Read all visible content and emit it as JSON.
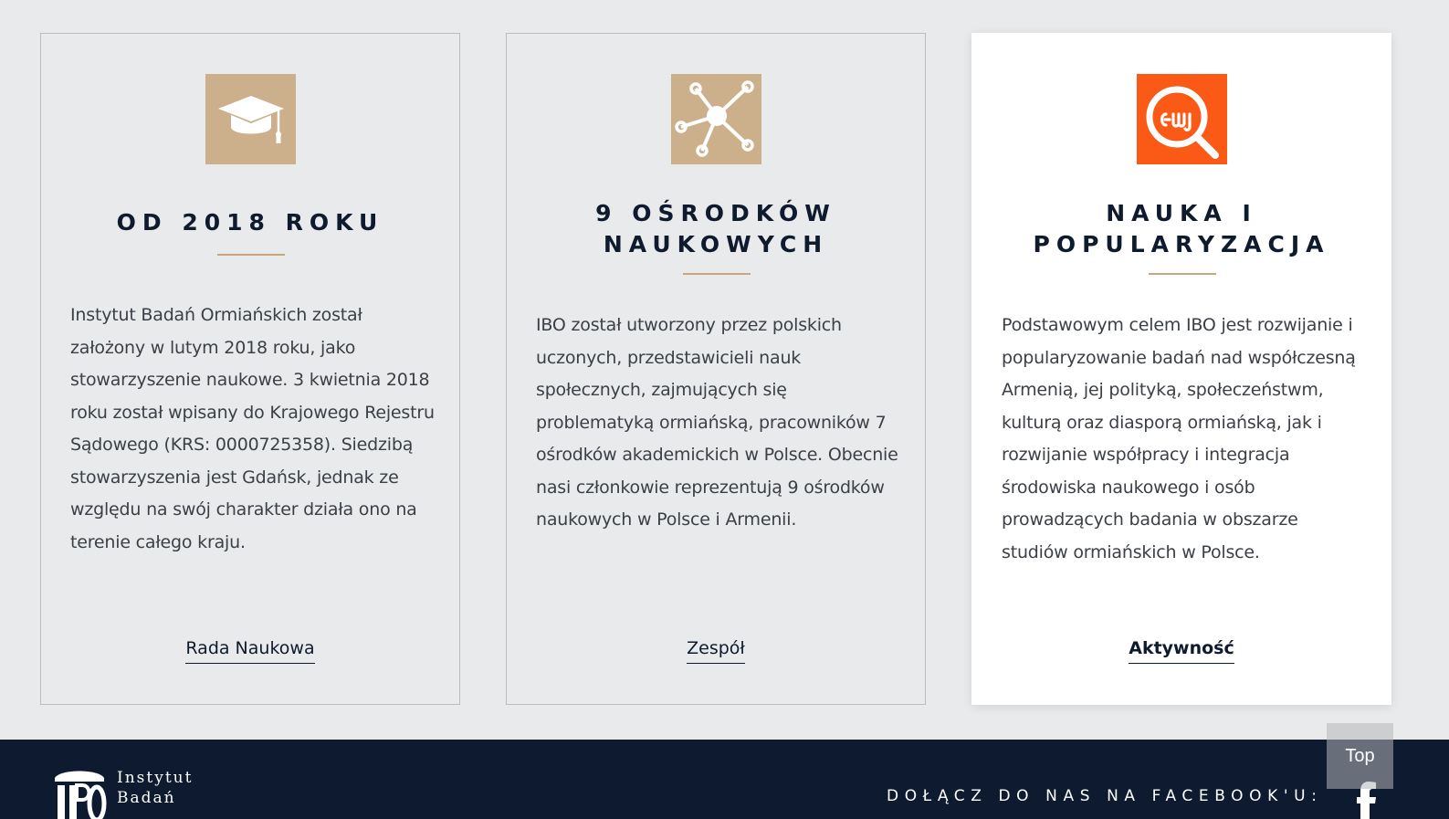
{
  "cards": [
    {
      "icon": "graduation-cap-icon",
      "icon_bg": "#cbb08b",
      "title": "OD 2018 ROKU",
      "text": "Instytut Badań Ormiańskich został założony w lutym 2018 roku, jako stowarzyszenie naukowe. 3 kwietnia 2018 roku został wpisany do Krajowego Rejestru Sądowego (KRS: 0000725358). Siedzibą stowarzyszenia jest Gdańsk, jednak ze względu na swój charakter działa ono na terenie całego kraju.",
      "link": "Rada Naukowa"
    },
    {
      "icon": "network-nodes-icon",
      "icon_bg": "#cbb08b",
      "title": "9 OŚRODKÓW NAUKOWYCH",
      "text": "IBO został utworzony przez polskich uczonych, przedstawicieli nauk społecznych, zajmujących się problematyką ormiańską, pracowników 7 ośrodków akademickich w Polsce. Obecnie nasi członkowie reprezentują 9 ośrodków naukowych w Polsce i Armenii.",
      "link": "Zespół"
    },
    {
      "icon": "armenian-search-icon",
      "icon_bg": "#fb5a16",
      "title": "NAUKA I POPULARYZACJA",
      "text": "Podstawowym celem IBO jest rozwijanie i popularyzowanie badań nad współczesną Armenią, jej polityką, społeczeństwm, kulturą oraz diasporą ormiańską, jak i rozwijanie współpracy i integracja środowiska naukowego i osób prowadzących badania w obszarze studiów ormiańskich w Polsce.",
      "link": "Aktywność"
    }
  ],
  "footer": {
    "logo_text_line1": "Instytut",
    "logo_text_line2": "Badań",
    "facebook_label": "DOŁĄCZ DO NAS NA FACEBOOK'U:",
    "facebook_icon": "facebook-icon"
  },
  "top_button": "Top",
  "colors": {
    "accent_gold": "#c9a77c",
    "accent_orange": "#fb5a16",
    "navy": "#0d1a2f",
    "background": "#e8eaec"
  }
}
